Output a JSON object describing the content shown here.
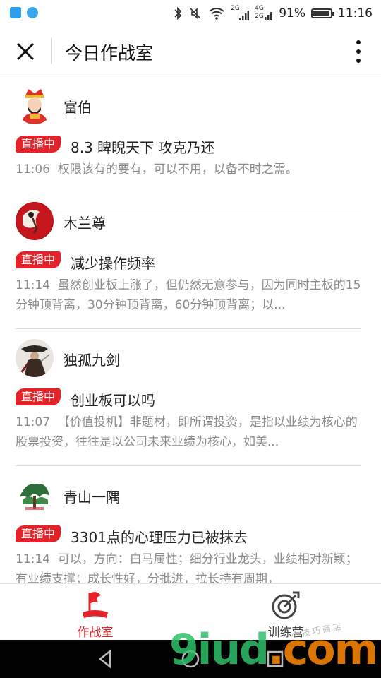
{
  "status_bar": {
    "network_small_top": "2G",
    "network_small_4g": "4G",
    "network_small_2g": "2G",
    "battery_text": "91%",
    "battery_level": 0.91,
    "time": "11:16"
  },
  "header": {
    "title": "今日作战室"
  },
  "feed": {
    "items": [
      {
        "author": "富伯",
        "badge": "直播中",
        "title": "8.3 睥睨天下 攻克乃还",
        "time": "11:06",
        "summary": "权限该有的要有，可以不用，以备不时之需。"
      },
      {
        "author": "木兰尊",
        "badge": "直播中",
        "title": "减少操作频率",
        "time": "11:14",
        "summary": "虽然创业板上涨了，但仍然无意参与，因为同时主板的15分钟顶背离，30分钟顶背离，60分钟顶背离；以..."
      },
      {
        "author": "独孤九剑",
        "badge": "直播中",
        "title": "创业板可以吗",
        "time": "11:07",
        "summary": "【价值投机】非题材，即所谓投资，是指以业绩为核心的股票投资，往往是以公司未来业绩为核心，如美..."
      },
      {
        "author": "青山一隅",
        "badge": "直播中",
        "title": "3301点的心理压力已被抹去",
        "time": "11:14",
        "summary": "可以，方向：白马属性；细分行业龙头，业绩相对新颖；有业绩支撑；成长性好，分批进，拉长持有周期，"
      }
    ]
  },
  "bottom_nav": {
    "tabs": [
      {
        "label": "作战室",
        "active": true
      },
      {
        "label": "训练营",
        "active": false
      }
    ]
  },
  "watermark": {
    "text_main": "9iud",
    "text_dot": ".com",
    "text_sub": "小技巧商店"
  },
  "colors": {
    "accent": "#e4222a",
    "summary_text": "#8a8a8a",
    "watermark_green": "#2fc06a",
    "watermark_orange": "#ff8a00"
  }
}
